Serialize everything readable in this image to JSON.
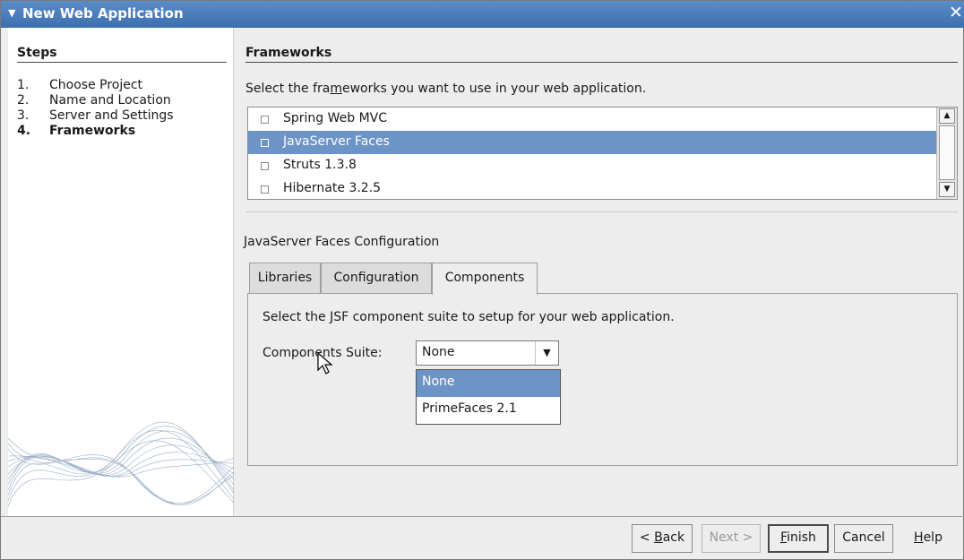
{
  "window": {
    "title": "New Web Application"
  },
  "steps": {
    "heading": "Steps",
    "items": [
      {
        "num": "1.",
        "label": "Choose Project"
      },
      {
        "num": "2.",
        "label": "Name and Location"
      },
      {
        "num": "3.",
        "label": "Server and Settings"
      },
      {
        "num": "4.",
        "label": "Frameworks"
      }
    ],
    "active_index": 3
  },
  "content": {
    "heading": "Frameworks",
    "intro_pre": "Select the fra",
    "intro_mnemonic": "m",
    "intro_post": "eworks you want to use in your web application.",
    "frameworks": [
      {
        "name": "Spring Web MVC",
        "checked": false,
        "selected": false
      },
      {
        "name": "JavaServer Faces",
        "checked": false,
        "selected": true
      },
      {
        "name": "Struts 1.3.8",
        "checked": false,
        "selected": false
      },
      {
        "name": "Hibernate 3.2.5",
        "checked": false,
        "selected": false
      }
    ],
    "config_title": "JavaServer Faces Configuration",
    "tabs": [
      {
        "label": "Libraries"
      },
      {
        "label": "Configuration"
      },
      {
        "label": "Components"
      }
    ],
    "active_tab": 2,
    "panel_text": "Select the JSF component suite to setup for your web application.",
    "components_label": "Components Suite:",
    "combo_value": "None",
    "dropdown_options": [
      {
        "label": "None",
        "selected": true
      },
      {
        "label": "PrimeFaces 2.1",
        "selected": false
      }
    ]
  },
  "footer": {
    "back_pre": "< ",
    "back_mn": "B",
    "back_post": "ack",
    "next": "Next >",
    "finish_mn": "F",
    "finish_post": "inish",
    "cancel": "Cancel",
    "help_mn": "H",
    "help_post": "elp"
  },
  "colors": {
    "titlebar": "#4a7dbd",
    "selection": "#6d94c6"
  }
}
